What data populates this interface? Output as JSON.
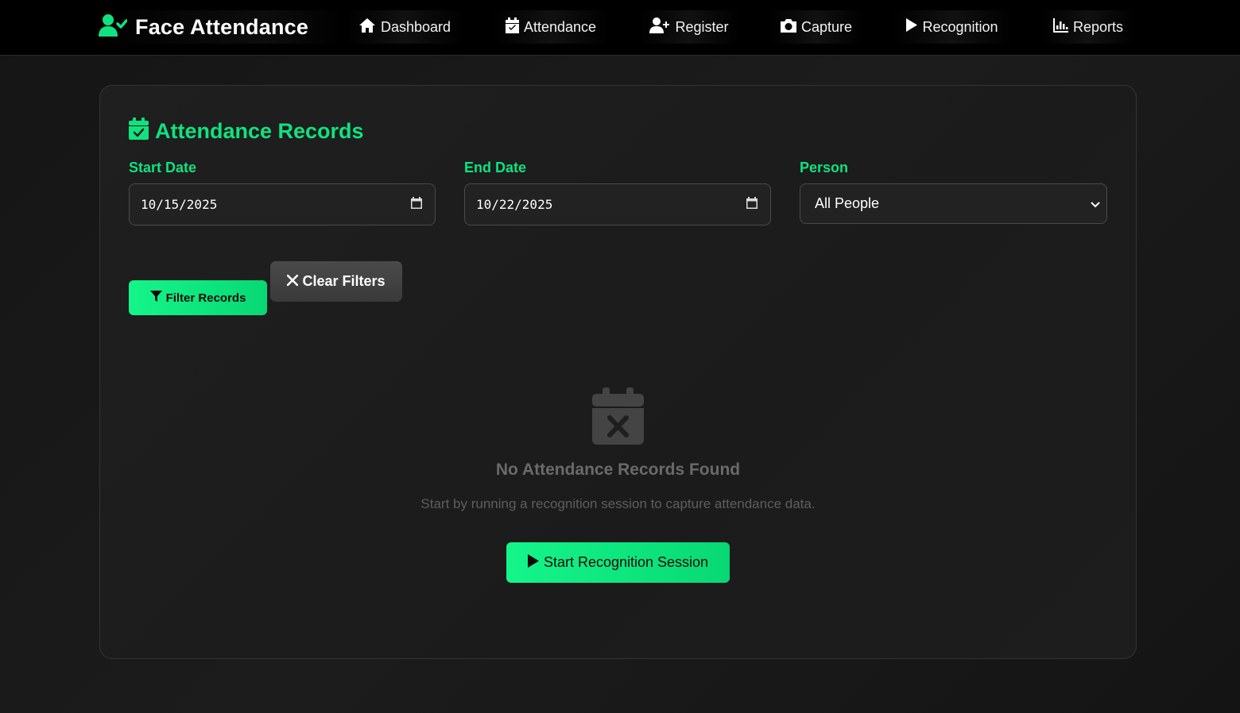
{
  "app": {
    "title": "Face Attendance"
  },
  "nav": {
    "items": [
      {
        "label": "Dashboard",
        "icon": "home-icon"
      },
      {
        "label": "Attendance",
        "icon": "calendar-check-icon"
      },
      {
        "label": "Register",
        "icon": "user-plus-icon"
      },
      {
        "label": "Capture",
        "icon": "camera-icon"
      },
      {
        "label": "Recognition",
        "icon": "play-icon"
      },
      {
        "label": "Reports",
        "icon": "chart-icon"
      }
    ]
  },
  "page": {
    "title": "Attendance Records"
  },
  "filters": {
    "start_label": "Start Date",
    "start_value": "10/15/2025",
    "end_label": "End Date",
    "end_value": "10/22/2025",
    "person_label": "Person",
    "person_selected": "All People",
    "filter_button": "Filter Records",
    "clear_button": "Clear Filters"
  },
  "empty_state": {
    "title": "No Attendance Records Found",
    "subtitle": "Start by running a recognition session to capture attendance data.",
    "action_label": "Start Recognition Session"
  },
  "colors": {
    "accent": "#10e27f",
    "background": "#161616",
    "card": "#1e1e1e",
    "navbar": "#000000"
  }
}
